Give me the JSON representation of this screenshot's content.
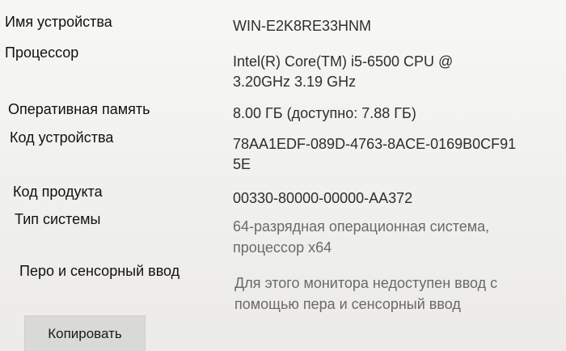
{
  "specs": {
    "device_name": {
      "label": "Имя устройства",
      "value": "WIN-E2K8RE33HNM"
    },
    "processor": {
      "label": "Процессор",
      "value_line1": "Intel(R) Core(TM) i5-6500 CPU @",
      "value_line2": "3.20GHz   3.19 GHz"
    },
    "ram": {
      "label": "Оперативная память",
      "value": "8.00 ГБ (доступно: 7.88 ГБ)"
    },
    "device_id": {
      "label": "Код устройства",
      "value_line1": "78AA1EDF-089D-4763-8ACE-0169B0CF91",
      "value_line2": "5E"
    },
    "product_id": {
      "label": "Код продукта",
      "value": "00330-80000-00000-AA372"
    },
    "system_type": {
      "label": "Тип системы",
      "value_line1": "64-разрядная операционная система,",
      "value_line2": "процессор x64"
    },
    "pen_touch": {
      "label": "Перо и сенсорный ввод",
      "value_line1": "Для этого монитора недоступен ввод с",
      "value_line2": "помощью пера и сенсорный ввод"
    }
  },
  "actions": {
    "copy_label": "Копировать"
  }
}
